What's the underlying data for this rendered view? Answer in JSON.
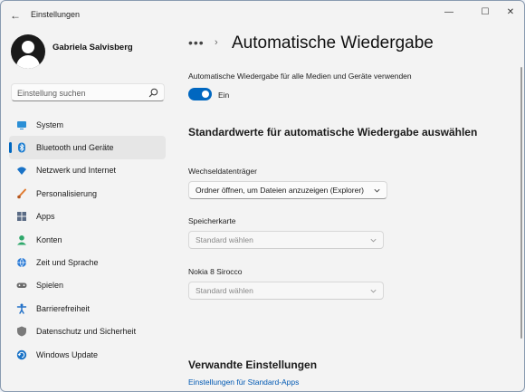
{
  "window": {
    "title": "Einstellungen",
    "back_glyph": "←",
    "minimize_glyph": "—",
    "maximize_glyph": "☐",
    "close_glyph": "✕"
  },
  "profile": {
    "name": "Gabriela Salvisberg"
  },
  "search": {
    "placeholder": "Einstellung suchen"
  },
  "sidebar": {
    "active_index": 1,
    "items": [
      {
        "label": "System",
        "icon": "system-icon",
        "color": "#2b8fd6"
      },
      {
        "label": "Bluetooth und Geräte",
        "icon": "bluetooth-icon",
        "color": "#1f7fd1"
      },
      {
        "label": "Netzwerk und Internet",
        "icon": "wifi-icon",
        "color": "#1a73c7"
      },
      {
        "label": "Personalisierung",
        "icon": "brush-icon",
        "color": "#e07a2f"
      },
      {
        "label": "Apps",
        "icon": "apps-icon",
        "color": "#5a6b85"
      },
      {
        "label": "Konten",
        "icon": "account-icon",
        "color": "#2fa86b"
      },
      {
        "label": "Zeit und Sprache",
        "icon": "globe-clock-icon",
        "color": "#2b7bd6"
      },
      {
        "label": "Spielen",
        "icon": "gamepad-icon",
        "color": "#6b6b6b"
      },
      {
        "label": "Barrierefreiheit",
        "icon": "accessibility-icon",
        "color": "#1f6fc7"
      },
      {
        "label": "Datenschutz und Sicherheit",
        "icon": "shield-icon",
        "color": "#7a7a7a"
      },
      {
        "label": "Windows Update",
        "icon": "update-icon",
        "color": "#1a73c7"
      }
    ]
  },
  "main": {
    "breadcrumb_dots": "•••",
    "breadcrumb_sep": "›",
    "title": "Automatische Wiedergabe",
    "autoplay_label": "Automatische Wiedergabe für alle Medien und Geräte verwenden",
    "autoplay_on": true,
    "toggle_state": "Ein",
    "section_title": "Standardwerte für automatische Wiedergabe auswählen",
    "devices": [
      {
        "label": "Wechseldatenträger",
        "value": "Ordner öffnen, um Dateien anzuzeigen (Explorer)",
        "enabled": true
      },
      {
        "label": "Speicherkarte",
        "value": "Standard wählen",
        "enabled": false
      },
      {
        "label": "Nokia 8 Sirocco",
        "value": "Standard wählen",
        "enabled": false
      }
    ],
    "related_title": "Verwandte Einstellungen",
    "related_link": "Einstellungen für Standard-Apps"
  },
  "colors": {
    "accent": "#0067c0",
    "link": "#0059b3"
  }
}
